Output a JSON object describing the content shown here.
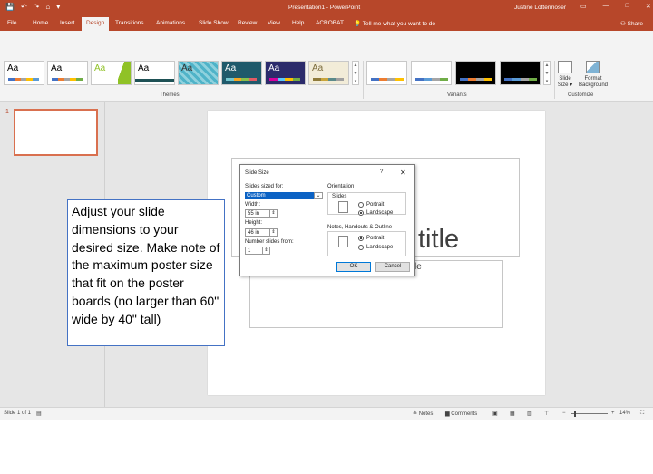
{
  "titlebar": {
    "qat": [
      "💾",
      "↶",
      "↷",
      "⌂",
      "▾"
    ],
    "doc_title": "Presentation1 - PowerPoint",
    "user": "Justine Lottermoser",
    "win_buttons": [
      "▭",
      "—",
      "□",
      "✕"
    ]
  },
  "tabs": {
    "items": [
      "File",
      "Home",
      "Insert",
      "Design",
      "Transitions",
      "Animations",
      "Slide Show",
      "Review",
      "View",
      "Help",
      "ACROBAT"
    ],
    "active": "Design",
    "tell_me": "Tell me what you want to do",
    "share": "Share"
  },
  "ribbon": {
    "themes_label": "Themes",
    "variants_label": "Variants",
    "customize_label": "Customize",
    "theme_text": "Aa",
    "slide_size_label": "Slide Size ▾",
    "format_bg_label": "Format Background",
    "scroll_glyphs": [
      "▲",
      "▼",
      "▾"
    ]
  },
  "slides_pane": {
    "slide_number": "1"
  },
  "slide": {
    "title_fragment": "title",
    "subtitle_fragment": "le"
  },
  "dialog": {
    "title": "Slide Size",
    "help": "?",
    "close": "✕",
    "sized_for_label": "Slides sized for:",
    "sized_for_value": "Custom",
    "width_label": "Width:",
    "width_value": "55 in",
    "height_label": "Height:",
    "height_value": "46 in",
    "number_from_label": "Number slides from:",
    "number_from_value": "1",
    "orientation_label": "Orientation",
    "slides_label": "Slides",
    "portrait": "Portrait",
    "landscape": "Landscape",
    "notes_label": "Notes, Handouts & Outline",
    "ok": "OK",
    "cancel": "Cancel",
    "slides_orientation_selected": "Landscape",
    "notes_orientation_selected": "Portrait"
  },
  "callout": {
    "text": "Adjust your slide dimensions to your desired size. Make note of the maximum poster size that fit on the poster boards (no larger than 60\" wide by 40\" tall)"
  },
  "statusbar": {
    "slide_info": "Slide 1 of 1",
    "notes": "Notes",
    "comments": "Comments",
    "zoom": "14%"
  },
  "colors": {
    "accent": "#b7472a",
    "selection": "#0b62c4",
    "callout_border": "#4472c4"
  }
}
